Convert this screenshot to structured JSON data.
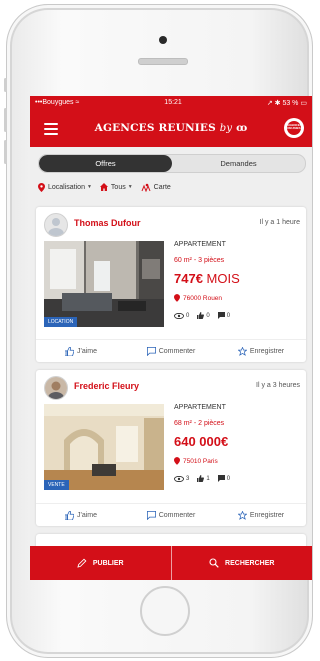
{
  "status": {
    "carrier": "Bouygues",
    "time": "15:21",
    "battery": "53 %"
  },
  "app": {
    "brand": "AGENCES REUNIES",
    "brand_by": "by"
  },
  "tabs": {
    "offers": "Offres",
    "requests": "Demandes"
  },
  "filters": {
    "location": "Localisation",
    "type": "Tous",
    "map": "Carte"
  },
  "listings": [
    {
      "author": "Thomas Dufour",
      "time": "Il y a 1 heure",
      "type": "APPARTEMENT",
      "surface": "60 m² - 3 pièces",
      "price": "747€",
      "price_unit": "MOIS",
      "city": "76000 Rouen",
      "tag": "LOCATION",
      "views": "0",
      "likes": "0",
      "comments": "0"
    },
    {
      "author": "Frederic Fleury",
      "time": "Il y a 3 heures",
      "type": "APPARTEMENT",
      "surface": "68 m² - 2 pièces",
      "price": "640 000€",
      "price_unit": "",
      "city": "75010 Paris",
      "tag": "VENTE",
      "views": "3",
      "likes": "1",
      "comments": "0"
    }
  ],
  "actions": {
    "like": "J'aime",
    "comment": "Commenter",
    "save": "Enregistrer"
  },
  "bottom": {
    "publish": "PUBLIER",
    "search": "RECHERCHER"
  },
  "colors": {
    "brand": "#d30f18",
    "tag": "#2b64b8"
  }
}
